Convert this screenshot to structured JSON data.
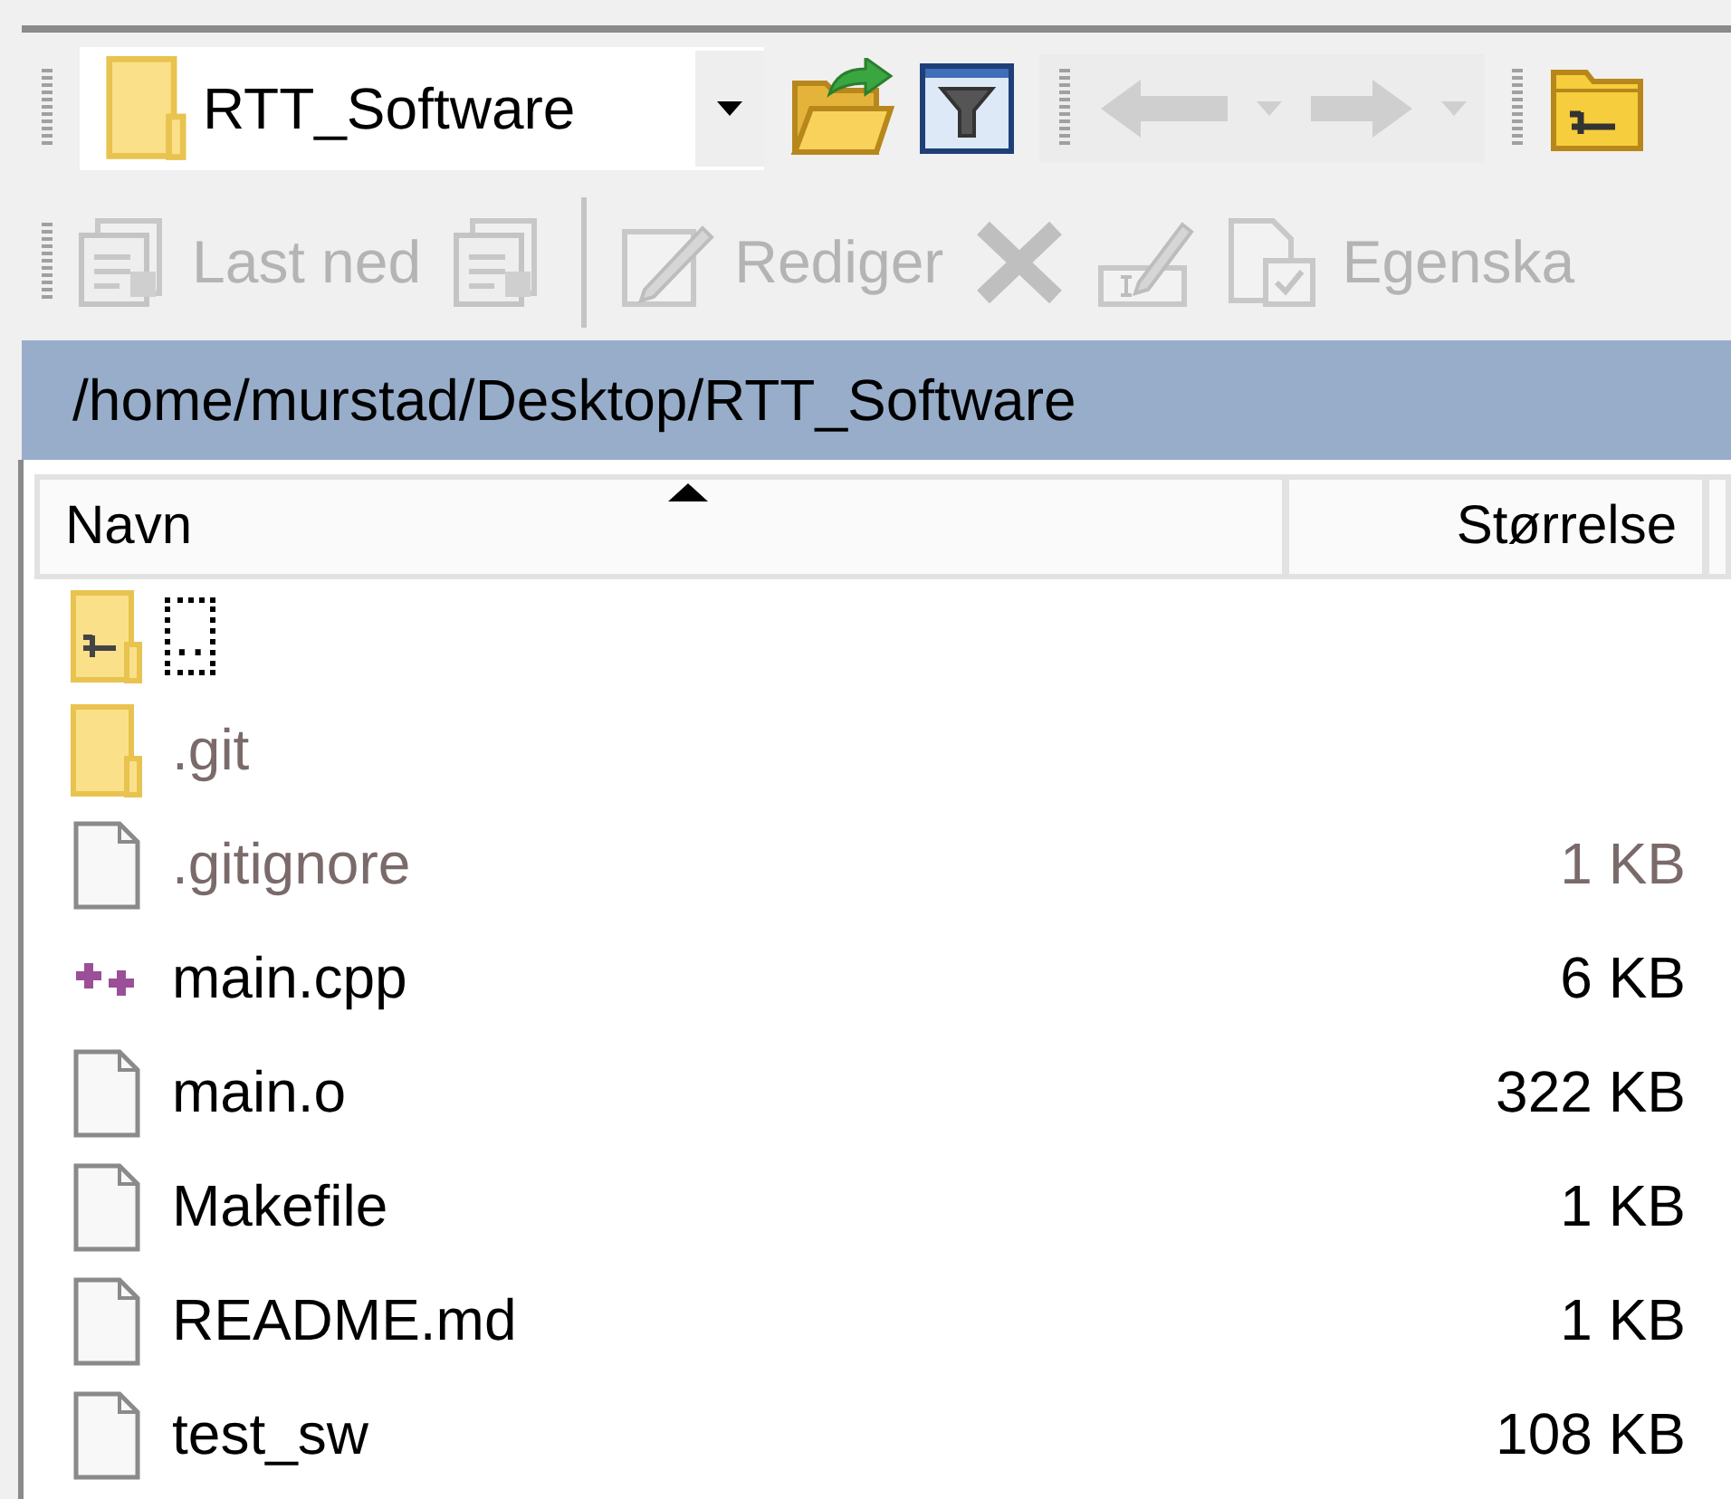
{
  "location": {
    "value": "RTT_Software"
  },
  "navigation": {
    "back_disabled": true,
    "forward_disabled": true
  },
  "toolbar": [
    {
      "kind": "download",
      "label": "Last ned",
      "disabled": true
    },
    {
      "kind": "download-options",
      "disabled": true
    },
    {
      "kind": "separator"
    },
    {
      "kind": "edit",
      "label": "Rediger",
      "disabled": true
    },
    {
      "kind": "delete",
      "disabled": true
    },
    {
      "kind": "rename",
      "disabled": true
    },
    {
      "kind": "properties",
      "label": "Egenska",
      "disabled": true
    }
  ],
  "path": "/home/murstad/Desktop/RTT_Software",
  "table": {
    "columns": [
      {
        "label": "Navn",
        "sorted": true
      },
      {
        "label": "Størrelse",
        "sorted": false
      }
    ],
    "rows": [
      {
        "kind": "parent",
        "name": "..",
        "focused": true,
        "hidden": false
      },
      {
        "kind": "folder",
        "name": ".git",
        "focused": false,
        "hidden": true
      },
      {
        "kind": "file",
        "name": ".gitignore",
        "size": "1 KB",
        "focused": false,
        "hidden": true
      },
      {
        "kind": "cpp",
        "name": "main.cpp",
        "size": "6 KB",
        "focused": false,
        "hidden": false
      },
      {
        "kind": "file",
        "name": "main.o",
        "size": "322 KB",
        "focused": false,
        "hidden": false
      },
      {
        "kind": "file",
        "name": "Makefile",
        "size": "1 KB",
        "focused": false,
        "hidden": false
      },
      {
        "kind": "file",
        "name": "README.md",
        "size": "1 KB",
        "focused": false,
        "hidden": false
      },
      {
        "kind": "file",
        "name": "test_sw",
        "size": "108 KB",
        "focused": false,
        "hidden": false
      }
    ]
  }
}
